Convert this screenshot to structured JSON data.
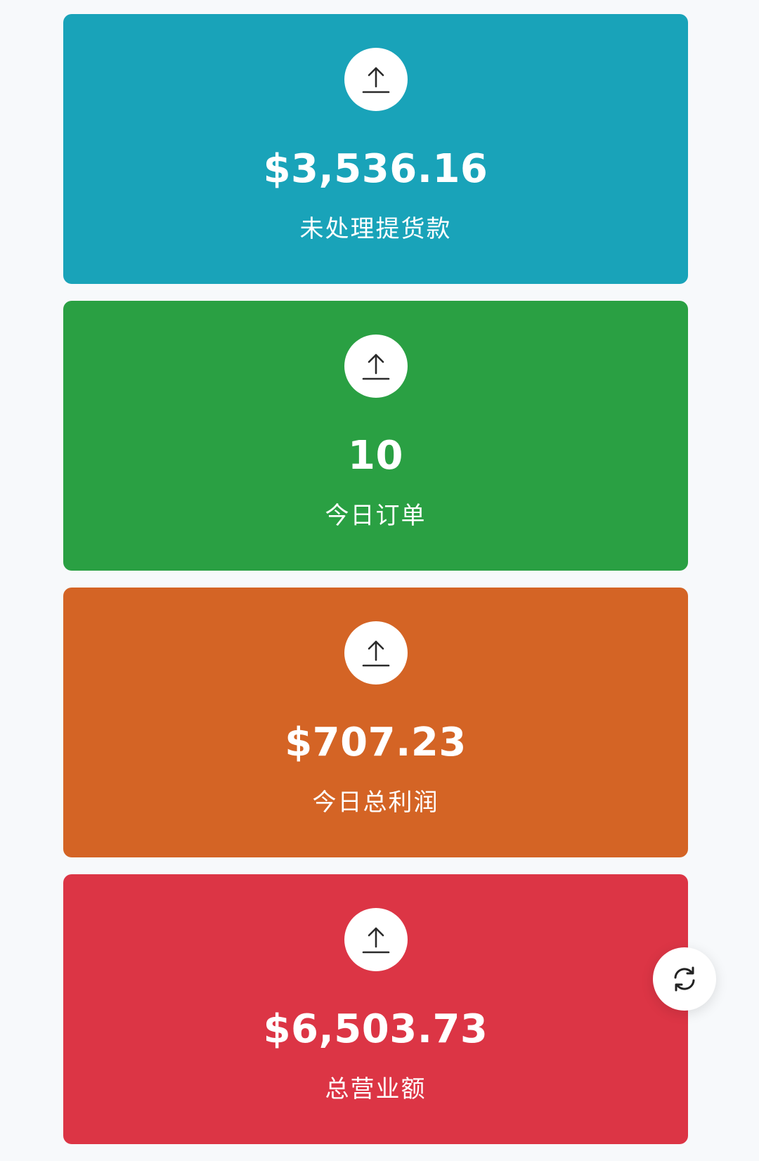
{
  "cards": [
    {
      "value": "$3,536.16",
      "label": "未处理提货款",
      "color": "#19a3b9",
      "icon": "upload-arrow-icon"
    },
    {
      "value": "10",
      "label": "今日订单",
      "color": "#2aa043",
      "icon": "upload-arrow-icon"
    },
    {
      "value": "$707.23",
      "label": "今日总利润",
      "color": "#d46425",
      "icon": "upload-arrow-icon"
    },
    {
      "value": "$6,503.73",
      "label": "总营业额",
      "color": "#dc3545",
      "icon": "upload-arrow-icon"
    }
  ],
  "refresh_button": {
    "icon": "refresh-icon"
  }
}
